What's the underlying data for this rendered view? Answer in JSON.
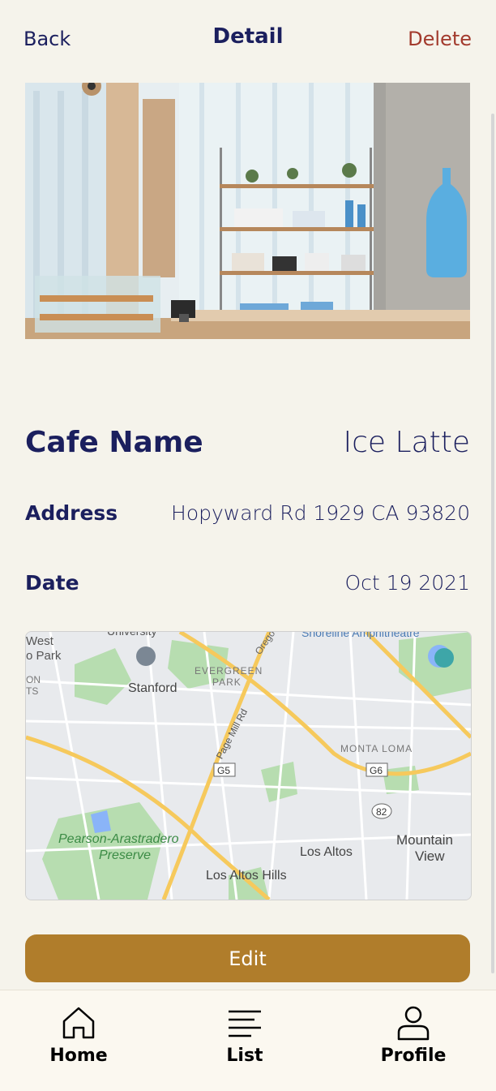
{
  "header": {
    "back_label": "Back",
    "title": "Detail",
    "delete_label": "Delete"
  },
  "photo": {
    "description_icon": "cafe-interior-photo"
  },
  "details": {
    "name_label": "Cafe Name",
    "name_value": "Ice Latte",
    "address_label": "Address",
    "address_value": "Hopyward Rd 1929 CA 93820",
    "date_label": "Date",
    "date_value": "Oct 19 2021"
  },
  "map": {
    "labels": {
      "university": "University",
      "west": "West",
      "park": "o Park",
      "stanford": "Stanford",
      "evergreen": "EVERGREEN",
      "park2": "PARK",
      "oregon": "Orego",
      "shoreline": "Shoreline Amphitheatre",
      "page_mill": "Page Mill Rd",
      "monta_loma": "MONTA LOMA",
      "g5": "G5",
      "g6": "G6",
      "r82": "82",
      "pearson": "Pearson-Arastradero",
      "preserve": "Preserve",
      "los_altos": "Los Altos",
      "mountain": "Mountain",
      "view": "View",
      "los_altos_hills": "Los Altos Hills",
      "on": "ON",
      "ts": "TS"
    }
  },
  "edit_label": "Edit",
  "tabs": [
    {
      "label": "Home",
      "icon": "home-icon"
    },
    {
      "label": "List",
      "icon": "list-icon"
    },
    {
      "label": "Profile",
      "icon": "profile-icon"
    }
  ],
  "colors": {
    "background": "#F5F3EB",
    "primary_text": "#1B1F5E",
    "delete": "#A23A2D",
    "edit_button": "#B07D2B"
  }
}
